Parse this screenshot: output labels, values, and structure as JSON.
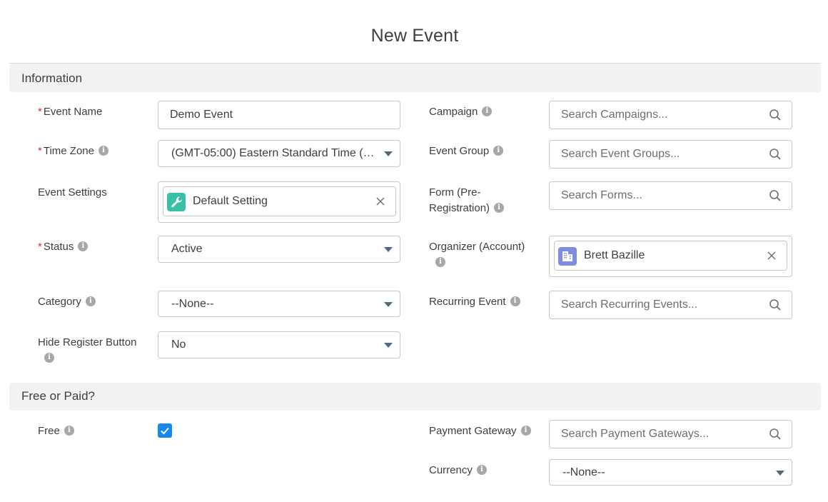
{
  "title": "New Event",
  "sections": {
    "information": "Information",
    "free_or_paid": "Free or Paid?"
  },
  "fields": {
    "event_name": {
      "label": "Event Name",
      "value": "Demo Event"
    },
    "time_zone": {
      "label": "Time Zone",
      "value": "(GMT-05:00) Eastern Standard Time (…"
    },
    "event_settings": {
      "label": "Event Settings",
      "value": "Default Setting"
    },
    "status": {
      "label": "Status",
      "value": "Active"
    },
    "category": {
      "label": "Category",
      "value": "--None--"
    },
    "hide_register_button": {
      "label": "Hide Register Button",
      "value": "No"
    },
    "campaign": {
      "label": "Campaign",
      "placeholder": "Search Campaigns..."
    },
    "event_group": {
      "label": "Event Group",
      "placeholder": "Search Event Groups..."
    },
    "form": {
      "label_line1": "Form (Pre-",
      "label_line2": "Registration)",
      "placeholder": "Search Forms..."
    },
    "organizer": {
      "label": "Organizer (Account)",
      "value": "Brett Bazille"
    },
    "recurring_event": {
      "label": "Recurring Event",
      "placeholder": "Search Recurring Events..."
    },
    "free": {
      "label": "Free",
      "checked": true
    },
    "payment_gateway": {
      "label": "Payment Gateway",
      "placeholder": "Search Payment Gateways..."
    },
    "currency": {
      "label": "Currency",
      "value": "--None--"
    }
  },
  "icons": {
    "required_marker": "*",
    "info": "i"
  },
  "colors": {
    "required": "#c23934",
    "checkbox": "#1589ee",
    "settings_icon_bg": "#3bc0a8",
    "account_icon_bg": "#7f8de1"
  }
}
